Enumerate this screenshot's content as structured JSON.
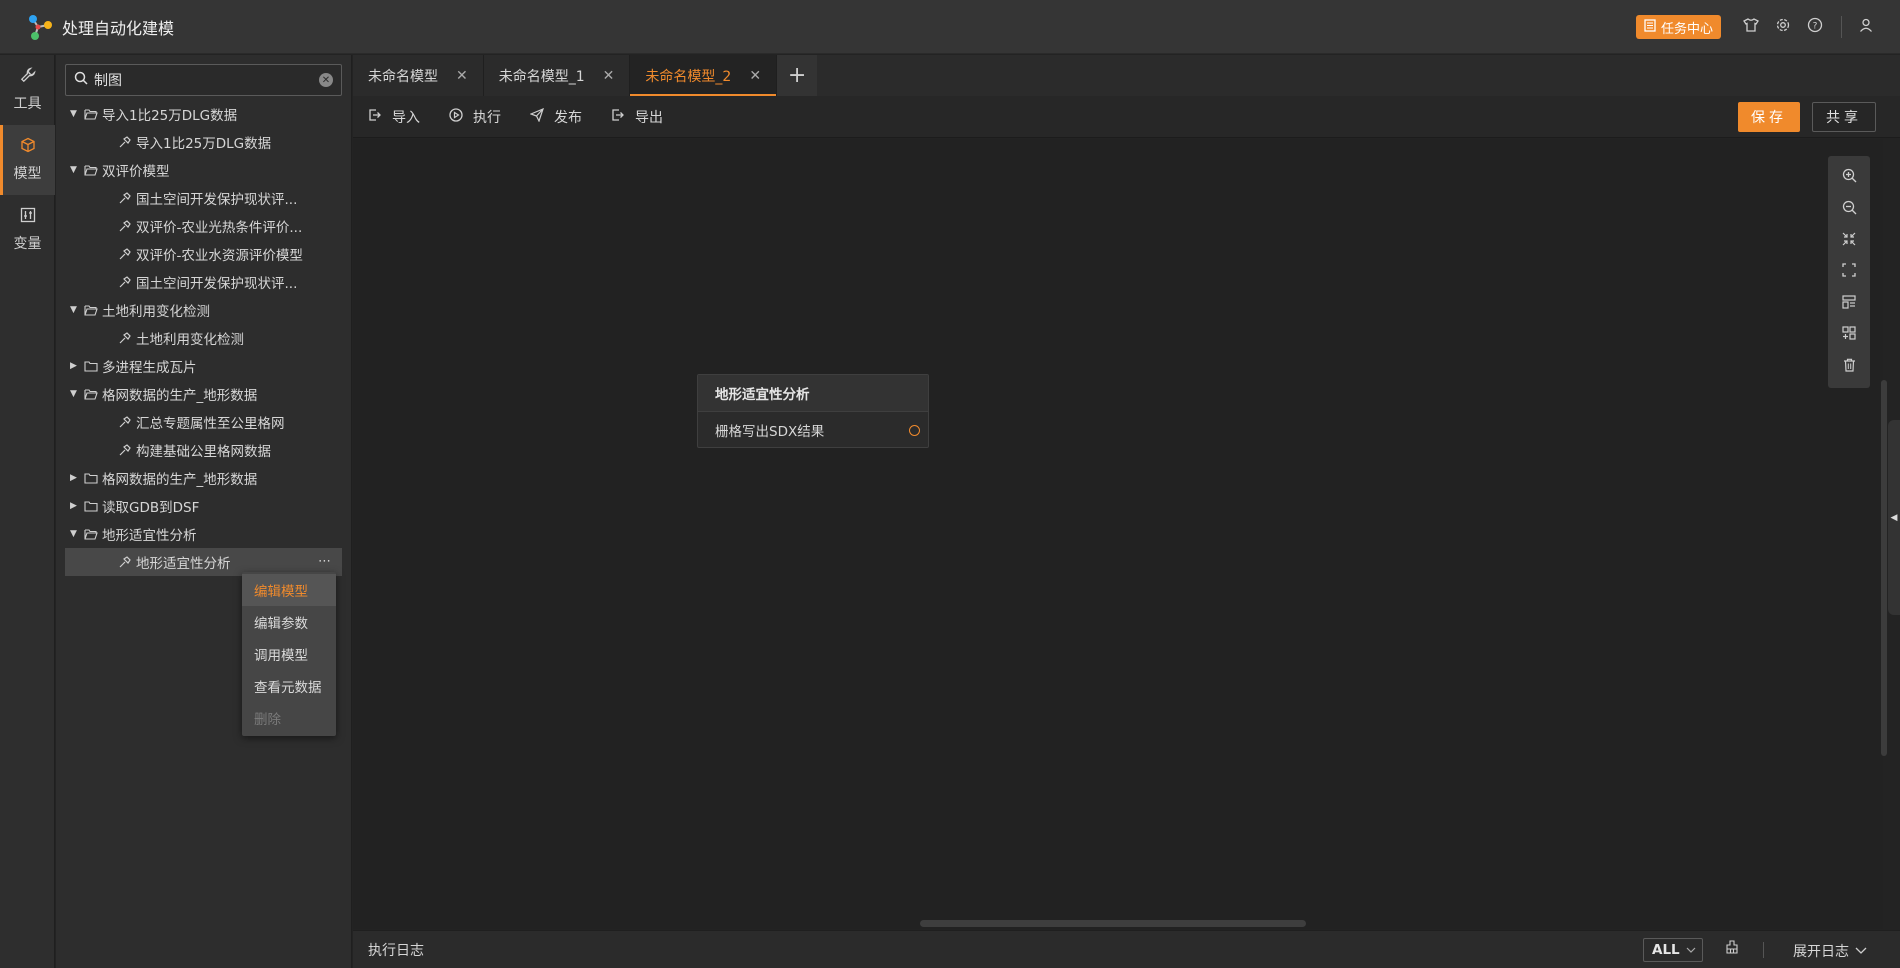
{
  "app": {
    "title": "处理自动化建模"
  },
  "header": {
    "task_center_label": "任务中心"
  },
  "sidenav": {
    "items": [
      {
        "label": "工具",
        "icon": "wrench-icon"
      },
      {
        "label": "模型",
        "icon": "cube-icon"
      },
      {
        "label": "变量",
        "icon": "variable-icon"
      }
    ],
    "active": "模型"
  },
  "search": {
    "value": "制图",
    "placeholder": ""
  },
  "tree": [
    {
      "type": "folder",
      "label": "导入1比25万DLG数据",
      "expanded": true
    },
    {
      "type": "leaf",
      "label": "导入1比25万DLG数据"
    },
    {
      "type": "folder",
      "label": "双评价模型",
      "expanded": true
    },
    {
      "type": "leaf",
      "label": "国土空间开发保护现状评..."
    },
    {
      "type": "leaf",
      "label": "双评价-农业光热条件评价..."
    },
    {
      "type": "leaf",
      "label": "双评价-农业水资源评价模型"
    },
    {
      "type": "leaf",
      "label": "国土空间开发保护现状评..."
    },
    {
      "type": "folder",
      "label": "土地利用变化检测",
      "expanded": true
    },
    {
      "type": "leaf",
      "label": "土地利用变化检测"
    },
    {
      "type": "folder",
      "label": "多进程生成瓦片",
      "expanded": false
    },
    {
      "type": "folder",
      "label": "格网数据的生产_地形数据",
      "expanded": true
    },
    {
      "type": "leaf",
      "label": "汇总专题属性至公里格网"
    },
    {
      "type": "leaf",
      "label": "构建基础公里格网数据"
    },
    {
      "type": "folder",
      "label": "格网数据的生产_地形数据",
      "expanded": false
    },
    {
      "type": "folder",
      "label": "读取GDB到DSF",
      "expanded": false
    },
    {
      "type": "folder",
      "label": "地形适宜性分析",
      "expanded": true
    },
    {
      "type": "leaf",
      "label": "地形适宜性分析",
      "selected": true
    }
  ],
  "context_menu": [
    {
      "label": "编辑模型",
      "highlighted": true
    },
    {
      "label": "编辑参数"
    },
    {
      "label": "调用模型"
    },
    {
      "label": "查看元数据"
    },
    {
      "label": "删除",
      "disabled": true
    }
  ],
  "tabs": [
    {
      "label": "未命名模型"
    },
    {
      "label": "未命名模型_1"
    },
    {
      "label": "未命名模型_2",
      "active": true
    }
  ],
  "toolbar": {
    "import_label": "导入",
    "execute_label": "执行",
    "publish_label": "发布",
    "export_label": "导出",
    "save_label": "保存",
    "share_label": "共享"
  },
  "node": {
    "title": "地形适宜性分析",
    "port_label": "栅格写出SDX结果"
  },
  "log": {
    "title": "执行日志",
    "filter_value": "ALL",
    "expand_label": "展开日志"
  },
  "colors": {
    "accent": "#f08a2c",
    "background": "#232323",
    "panel": "#2d2d2d"
  }
}
